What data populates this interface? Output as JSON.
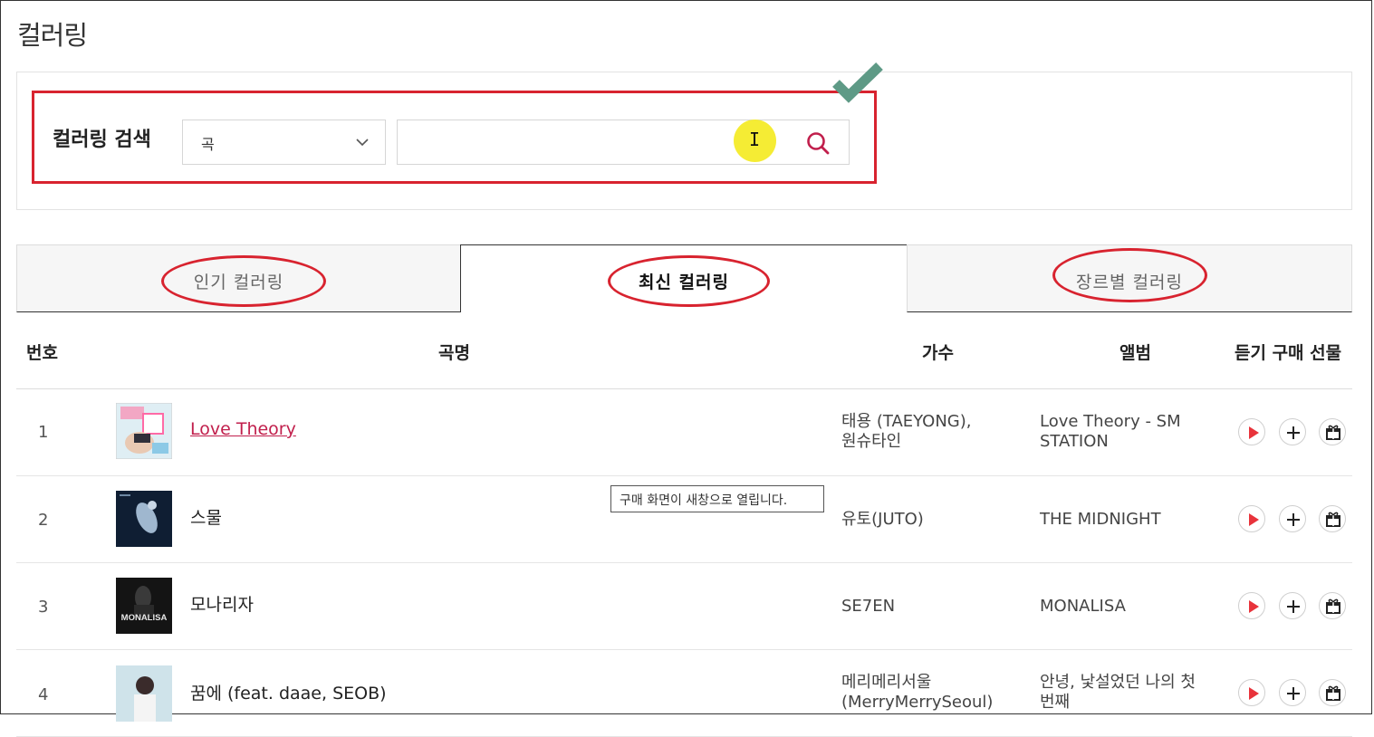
{
  "page": {
    "title": "컬러링"
  },
  "search": {
    "label": "컬러링 검색",
    "category_selected": "곡",
    "query_value": ""
  },
  "tabs": [
    {
      "label": "인기 컬러링",
      "active": false
    },
    {
      "label": "최신 컬러링",
      "active": true
    },
    {
      "label": "장르별 컬러링",
      "active": false
    }
  ],
  "table": {
    "columns": {
      "number": "번호",
      "title": "곡명",
      "artist": "가수",
      "album": "앨범",
      "actions": "듣기 구매 선물"
    },
    "rows": [
      {
        "number": "1",
        "title": "Love Theory",
        "artist_lines": [
          "태용 (TAEYONG),",
          "원슈타인"
        ],
        "album_lines": [
          "Love Theory - SM",
          "STATION"
        ],
        "cover": "love-theory-cover"
      },
      {
        "number": "2",
        "title": "스물",
        "artist_lines": [
          "유토(JUTO)"
        ],
        "album_lines": [
          "THE MIDNIGHT"
        ],
        "cover": "the-midnight-cover"
      },
      {
        "number": "3",
        "title": "모나리자",
        "artist_lines": [
          "SE7EN"
        ],
        "album_lines": [
          "MONALISA"
        ],
        "cover": "monalisa-cover",
        "cover_text": "MONALISA"
      },
      {
        "number": "4",
        "title": "꿈에 (feat. daae, SEOB)",
        "artist_lines": [
          "메리메리서울",
          "(MerryMerrySeoul)"
        ],
        "album_lines": [
          "안녕, 낯설었던 나의 첫",
          "번째"
        ],
        "cover": "first-cover"
      }
    ]
  },
  "tooltip": {
    "text": "구매 화면이 새창으로 열립니다."
  },
  "colors": {
    "annotation_red": "#d8232f",
    "check_green": "#5e9a86",
    "cursor_highlight": "#f5ec34",
    "link": "#c11f4c",
    "play_red": "#e8333b"
  },
  "icons": {
    "search": "search-icon",
    "dropdown": "chevron-down-icon",
    "check": "check-mark-icon",
    "play": "play-icon",
    "purchase": "plus-icon",
    "gift": "gift-icon"
  }
}
